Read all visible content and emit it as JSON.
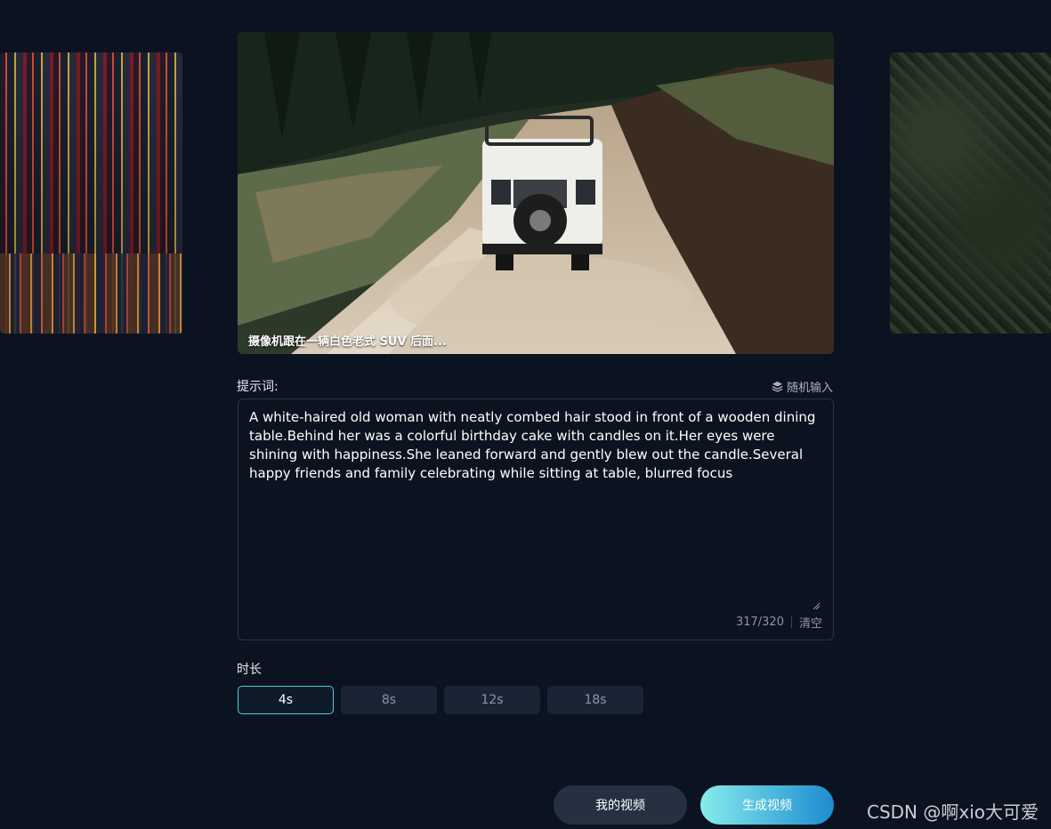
{
  "carousel": {
    "main_caption": "摄像机跟在一辆白色老式 SUV 后面..."
  },
  "prompt": {
    "label": "提示词:",
    "random_label": "随机输入",
    "text": "A white-haired old woman with neatly combed hair stood in front of a wooden dining table.Behind her was a colorful birthday cake with candles on it.Her eyes were shining with happiness.She leaned forward and gently blew out the candle.Several happy friends and family celebrating while sitting at table, blurred focus",
    "counter": "317/320",
    "clear_label": "清空"
  },
  "duration": {
    "label": "时长",
    "options": [
      "4s",
      "8s",
      "12s",
      "18s"
    ],
    "selected": "4s"
  },
  "actions": {
    "my_videos": "我的视频",
    "generate": "生成视频"
  },
  "watermark": "CSDN @啊xio大可爱",
  "colors": {
    "background": "#0b1320",
    "accent": "#3ed2dd",
    "generate_gradient_start": "#86ecec",
    "generate_gradient_end": "#1c8ccf"
  }
}
